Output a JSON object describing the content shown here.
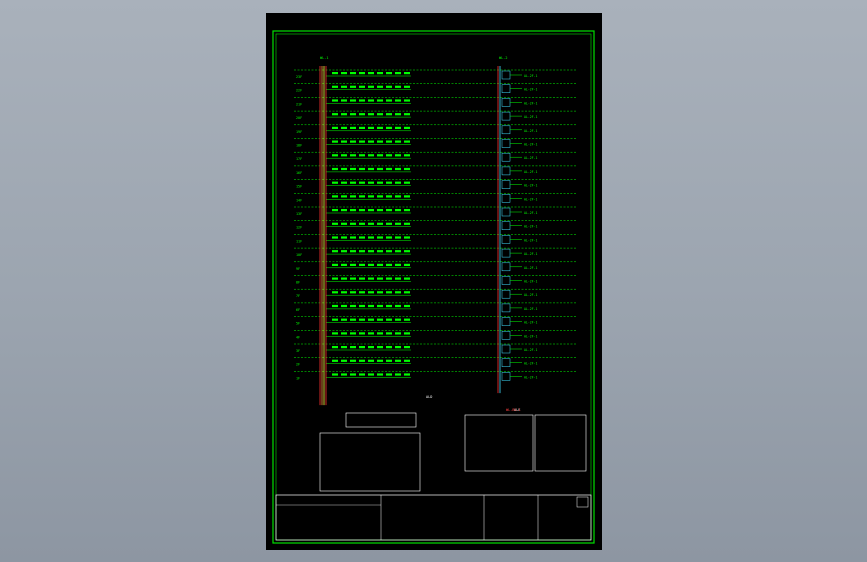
{
  "viewport": {
    "background_top": "#a9b1bb",
    "background_bottom": "#8d96a2"
  },
  "drawing": {
    "paper_color": "#000000",
    "frame_color": "#00e000",
    "border_color": "#ffffff",
    "riser_left_label": "WL-1",
    "riser_right_label": "WL-2",
    "floor_count": 23,
    "floor_labels": [
      "23F",
      "22F",
      "21F",
      "20F",
      "19F",
      "18F",
      "17F",
      "16F",
      "15F",
      "14F",
      "13F",
      "12F",
      "11F",
      "10F",
      "9F",
      "8F",
      "7F",
      "6F",
      "5F",
      "4F",
      "3F",
      "2F",
      "1F"
    ],
    "right_bus_label": "AL-2F-1",
    "bottom_tags": [
      "ALD",
      "ALE",
      "WL-B1-1"
    ],
    "colors": {
      "floor_line": "#00ff00",
      "text": "#00ff00",
      "riser_red": "#ff3030",
      "riser_orange": "#ffa040",
      "riser_yellow": "#ffff40",
      "riser_cyan": "#40e0ff",
      "accent_white": "#ffffff"
    },
    "title_block": {
      "present": true
    }
  }
}
